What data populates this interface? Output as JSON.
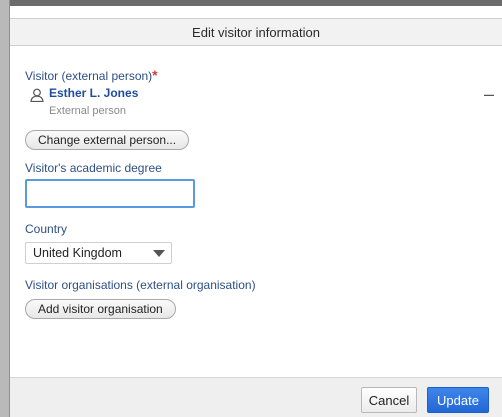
{
  "dialog": {
    "title": "Edit visitor information"
  },
  "visitor": {
    "label": "Visitor (external person)",
    "required_mark": "*",
    "person_icon": "person-icon",
    "name": "Esther L. Jones",
    "type": "External person",
    "remove_icon": "minus-icon",
    "change_button": "Change external person..."
  },
  "degree": {
    "label": "Visitor's academic degree",
    "value": ""
  },
  "country": {
    "label": "Country",
    "selected": "United Kingdom"
  },
  "organisations": {
    "label": "Visitor organisations (external organisation)",
    "add_button": "Add visitor organisation"
  },
  "footer": {
    "cancel_label": "Cancel",
    "update_label": "Update"
  },
  "colors": {
    "label_blue": "#2e4f87",
    "name_blue": "#1f4d9e",
    "required_red": "#d43b3b",
    "primary_button": "#2d72e0",
    "focus_border": "#5a9ae0"
  }
}
